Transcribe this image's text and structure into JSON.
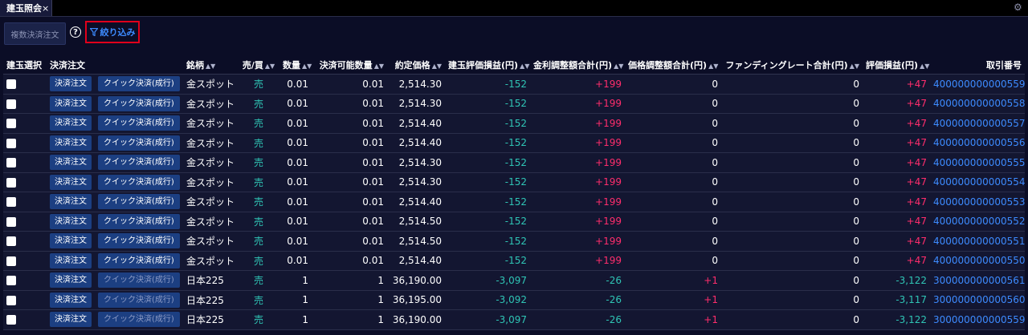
{
  "tab": {
    "label": "建玉照会",
    "close": "×"
  },
  "toolbar": {
    "multi_settle": "複数決済注文",
    "help": "?",
    "filter": "絞り込み"
  },
  "columns": {
    "select": "建玉選択",
    "order": "決済注文",
    "symbol": "銘柄",
    "side": "売/買",
    "qty": "数量",
    "avail": "決済可能数量",
    "price": "約定価格",
    "eval_pl": "建玉評価損益(円)",
    "interest": "金利調整額合計(円)",
    "price_adj": "価格調整額合計(円)",
    "funding": "ファンディングレート合計(円)",
    "total_pl": "評価損益(円)",
    "trade_no": "取引番号"
  },
  "rows": [
    {
      "settle": "決済注文",
      "quick": "クイック決済(成行)",
      "symbol": "金スポット",
      "side": "売",
      "qty": "0.01",
      "avail": "0.01",
      "price": "2,514.30",
      "eval_pl": "-152",
      "interest": "+199",
      "price_adj": "0",
      "funding": "0",
      "total_pl": "+47",
      "trade_no": "400000000000559"
    },
    {
      "settle": "決済注文",
      "quick": "クイック決済(成行)",
      "symbol": "金スポット",
      "side": "売",
      "qty": "0.01",
      "avail": "0.01",
      "price": "2,514.30",
      "eval_pl": "-152",
      "interest": "+199",
      "price_adj": "0",
      "funding": "0",
      "total_pl": "+47",
      "trade_no": "400000000000558"
    },
    {
      "settle": "決済注文",
      "quick": "クイック決済(成行)",
      "symbol": "金スポット",
      "side": "売",
      "qty": "0.01",
      "avail": "0.01",
      "price": "2,514.40",
      "eval_pl": "-152",
      "interest": "+199",
      "price_adj": "0",
      "funding": "0",
      "total_pl": "+47",
      "trade_no": "400000000000557"
    },
    {
      "settle": "決済注文",
      "quick": "クイック決済(成行)",
      "symbol": "金スポット",
      "side": "売",
      "qty": "0.01",
      "avail": "0.01",
      "price": "2,514.40",
      "eval_pl": "-152",
      "interest": "+199",
      "price_adj": "0",
      "funding": "0",
      "total_pl": "+47",
      "trade_no": "400000000000556"
    },
    {
      "settle": "決済注文",
      "quick": "クイック決済(成行)",
      "symbol": "金スポット",
      "side": "売",
      "qty": "0.01",
      "avail": "0.01",
      "price": "2,514.30",
      "eval_pl": "-152",
      "interest": "+199",
      "price_adj": "0",
      "funding": "0",
      "total_pl": "+47",
      "trade_no": "400000000000555"
    },
    {
      "settle": "決済注文",
      "quick": "クイック決済(成行)",
      "symbol": "金スポット",
      "side": "売",
      "qty": "0.01",
      "avail": "0.01",
      "price": "2,514.30",
      "eval_pl": "-152",
      "interest": "+199",
      "price_adj": "0",
      "funding": "0",
      "total_pl": "+47",
      "trade_no": "400000000000554"
    },
    {
      "settle": "決済注文",
      "quick": "クイック決済(成行)",
      "symbol": "金スポット",
      "side": "売",
      "qty": "0.01",
      "avail": "0.01",
      "price": "2,514.40",
      "eval_pl": "-152",
      "interest": "+199",
      "price_adj": "0",
      "funding": "0",
      "total_pl": "+47",
      "trade_no": "400000000000553"
    },
    {
      "settle": "決済注文",
      "quick": "クイック決済(成行)",
      "symbol": "金スポット",
      "side": "売",
      "qty": "0.01",
      "avail": "0.01",
      "price": "2,514.50",
      "eval_pl": "-152",
      "interest": "+199",
      "price_adj": "0",
      "funding": "0",
      "total_pl": "+47",
      "trade_no": "400000000000552"
    },
    {
      "settle": "決済注文",
      "quick": "クイック決済(成行)",
      "symbol": "金スポット",
      "side": "売",
      "qty": "0.01",
      "avail": "0.01",
      "price": "2,514.50",
      "eval_pl": "-152",
      "interest": "+199",
      "price_adj": "0",
      "funding": "0",
      "total_pl": "+47",
      "trade_no": "400000000000551"
    },
    {
      "settle": "決済注文",
      "quick": "クイック決済(成行)",
      "symbol": "金スポット",
      "side": "売",
      "qty": "0.01",
      "avail": "0.01",
      "price": "2,514.40",
      "eval_pl": "-152",
      "interest": "+199",
      "price_adj": "0",
      "funding": "0",
      "total_pl": "+47",
      "trade_no": "400000000000550"
    },
    {
      "settle": "決済注文",
      "quick": "クイック決済(成行)",
      "symbol": "日本225",
      "side": "売",
      "qty": "1",
      "avail": "1",
      "price": "36,190.00",
      "eval_pl": "-3,097",
      "interest": "-26",
      "price_adj": "+1",
      "funding": "0",
      "total_pl": "-3,122",
      "trade_no": "300000000000561"
    },
    {
      "settle": "決済注文",
      "quick": "クイック決済(成行)",
      "symbol": "日本225",
      "side": "売",
      "qty": "1",
      "avail": "1",
      "price": "36,195.00",
      "eval_pl": "-3,092",
      "interest": "-26",
      "price_adj": "+1",
      "funding": "0",
      "total_pl": "-3,117",
      "trade_no": "300000000000560"
    },
    {
      "settle": "決済注文",
      "quick": "クイック決済(成行)",
      "symbol": "日本225",
      "side": "売",
      "qty": "1",
      "avail": "1",
      "price": "36,190.00",
      "eval_pl": "-3,097",
      "interest": "-26",
      "price_adj": "+1",
      "funding": "0",
      "total_pl": "-3,122",
      "trade_no": "300000000000559"
    }
  ]
}
